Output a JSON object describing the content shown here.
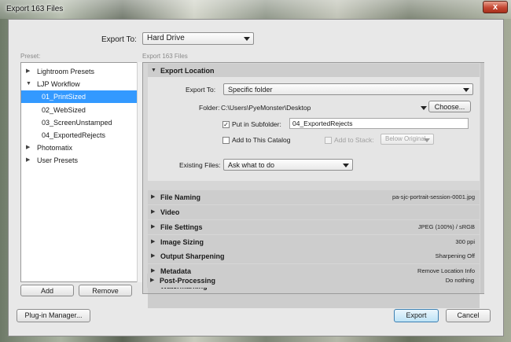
{
  "window": {
    "title": "Export 163 Files",
    "close_label": "x"
  },
  "export_to": {
    "label": "Export To:",
    "value": "Hard Drive"
  },
  "preset_label": "Preset:",
  "export_count_label": "Export 163 Files",
  "presets": [
    {
      "label": "Lightroom Presets",
      "expanded": false
    },
    {
      "label": "LJP Workflow",
      "expanded": true
    },
    {
      "label": "01_PrintSized",
      "selected": true
    },
    {
      "label": "02_WebSized"
    },
    {
      "label": "03_ScreenUnstamped"
    },
    {
      "label": "04_ExportedRejects"
    },
    {
      "label": "Photomatix",
      "expanded": false
    },
    {
      "label": "User Presets",
      "expanded": false
    }
  ],
  "buttons": {
    "add": "Add",
    "remove": "Remove",
    "plugin_manager": "Plug-in Manager...",
    "export": "Export",
    "cancel": "Cancel",
    "choose": "Choose..."
  },
  "export_location": {
    "title": "Export Location",
    "export_to_label": "Export To:",
    "export_to_value": "Specific folder",
    "folder_label": "Folder:",
    "folder_path": "C:\\Users\\PyeMonster\\Desktop",
    "subfolder_label": "Put in Subfolder:",
    "subfolder_checked": true,
    "subfolder_value": "04_ExportedRejects",
    "catalog_label": "Add to This Catalog",
    "catalog_checked": false,
    "stack_label": "Add to Stack:",
    "stack_value": "Below Original",
    "existing_label": "Existing Files:",
    "existing_value": "Ask what to do"
  },
  "sections": [
    {
      "name": "File Naming",
      "summary": "pa-sjc-portrait-session-0001.jpg"
    },
    {
      "name": "Video",
      "summary": ""
    },
    {
      "name": "File Settings",
      "summary": "JPEG (100%) / sRGB"
    },
    {
      "name": "Image Sizing",
      "summary": "300 ppi"
    },
    {
      "name": "Output Sharpening",
      "summary": "Sharpening Off"
    },
    {
      "name": "Metadata",
      "summary": "Remove Location Info"
    },
    {
      "name": "Watermarking",
      "summary": "No watermark"
    },
    {
      "name": "Post-Processing",
      "summary": "Do nothing"
    }
  ],
  "icons": {
    "expanded": "▼",
    "collapsed": "▶"
  }
}
